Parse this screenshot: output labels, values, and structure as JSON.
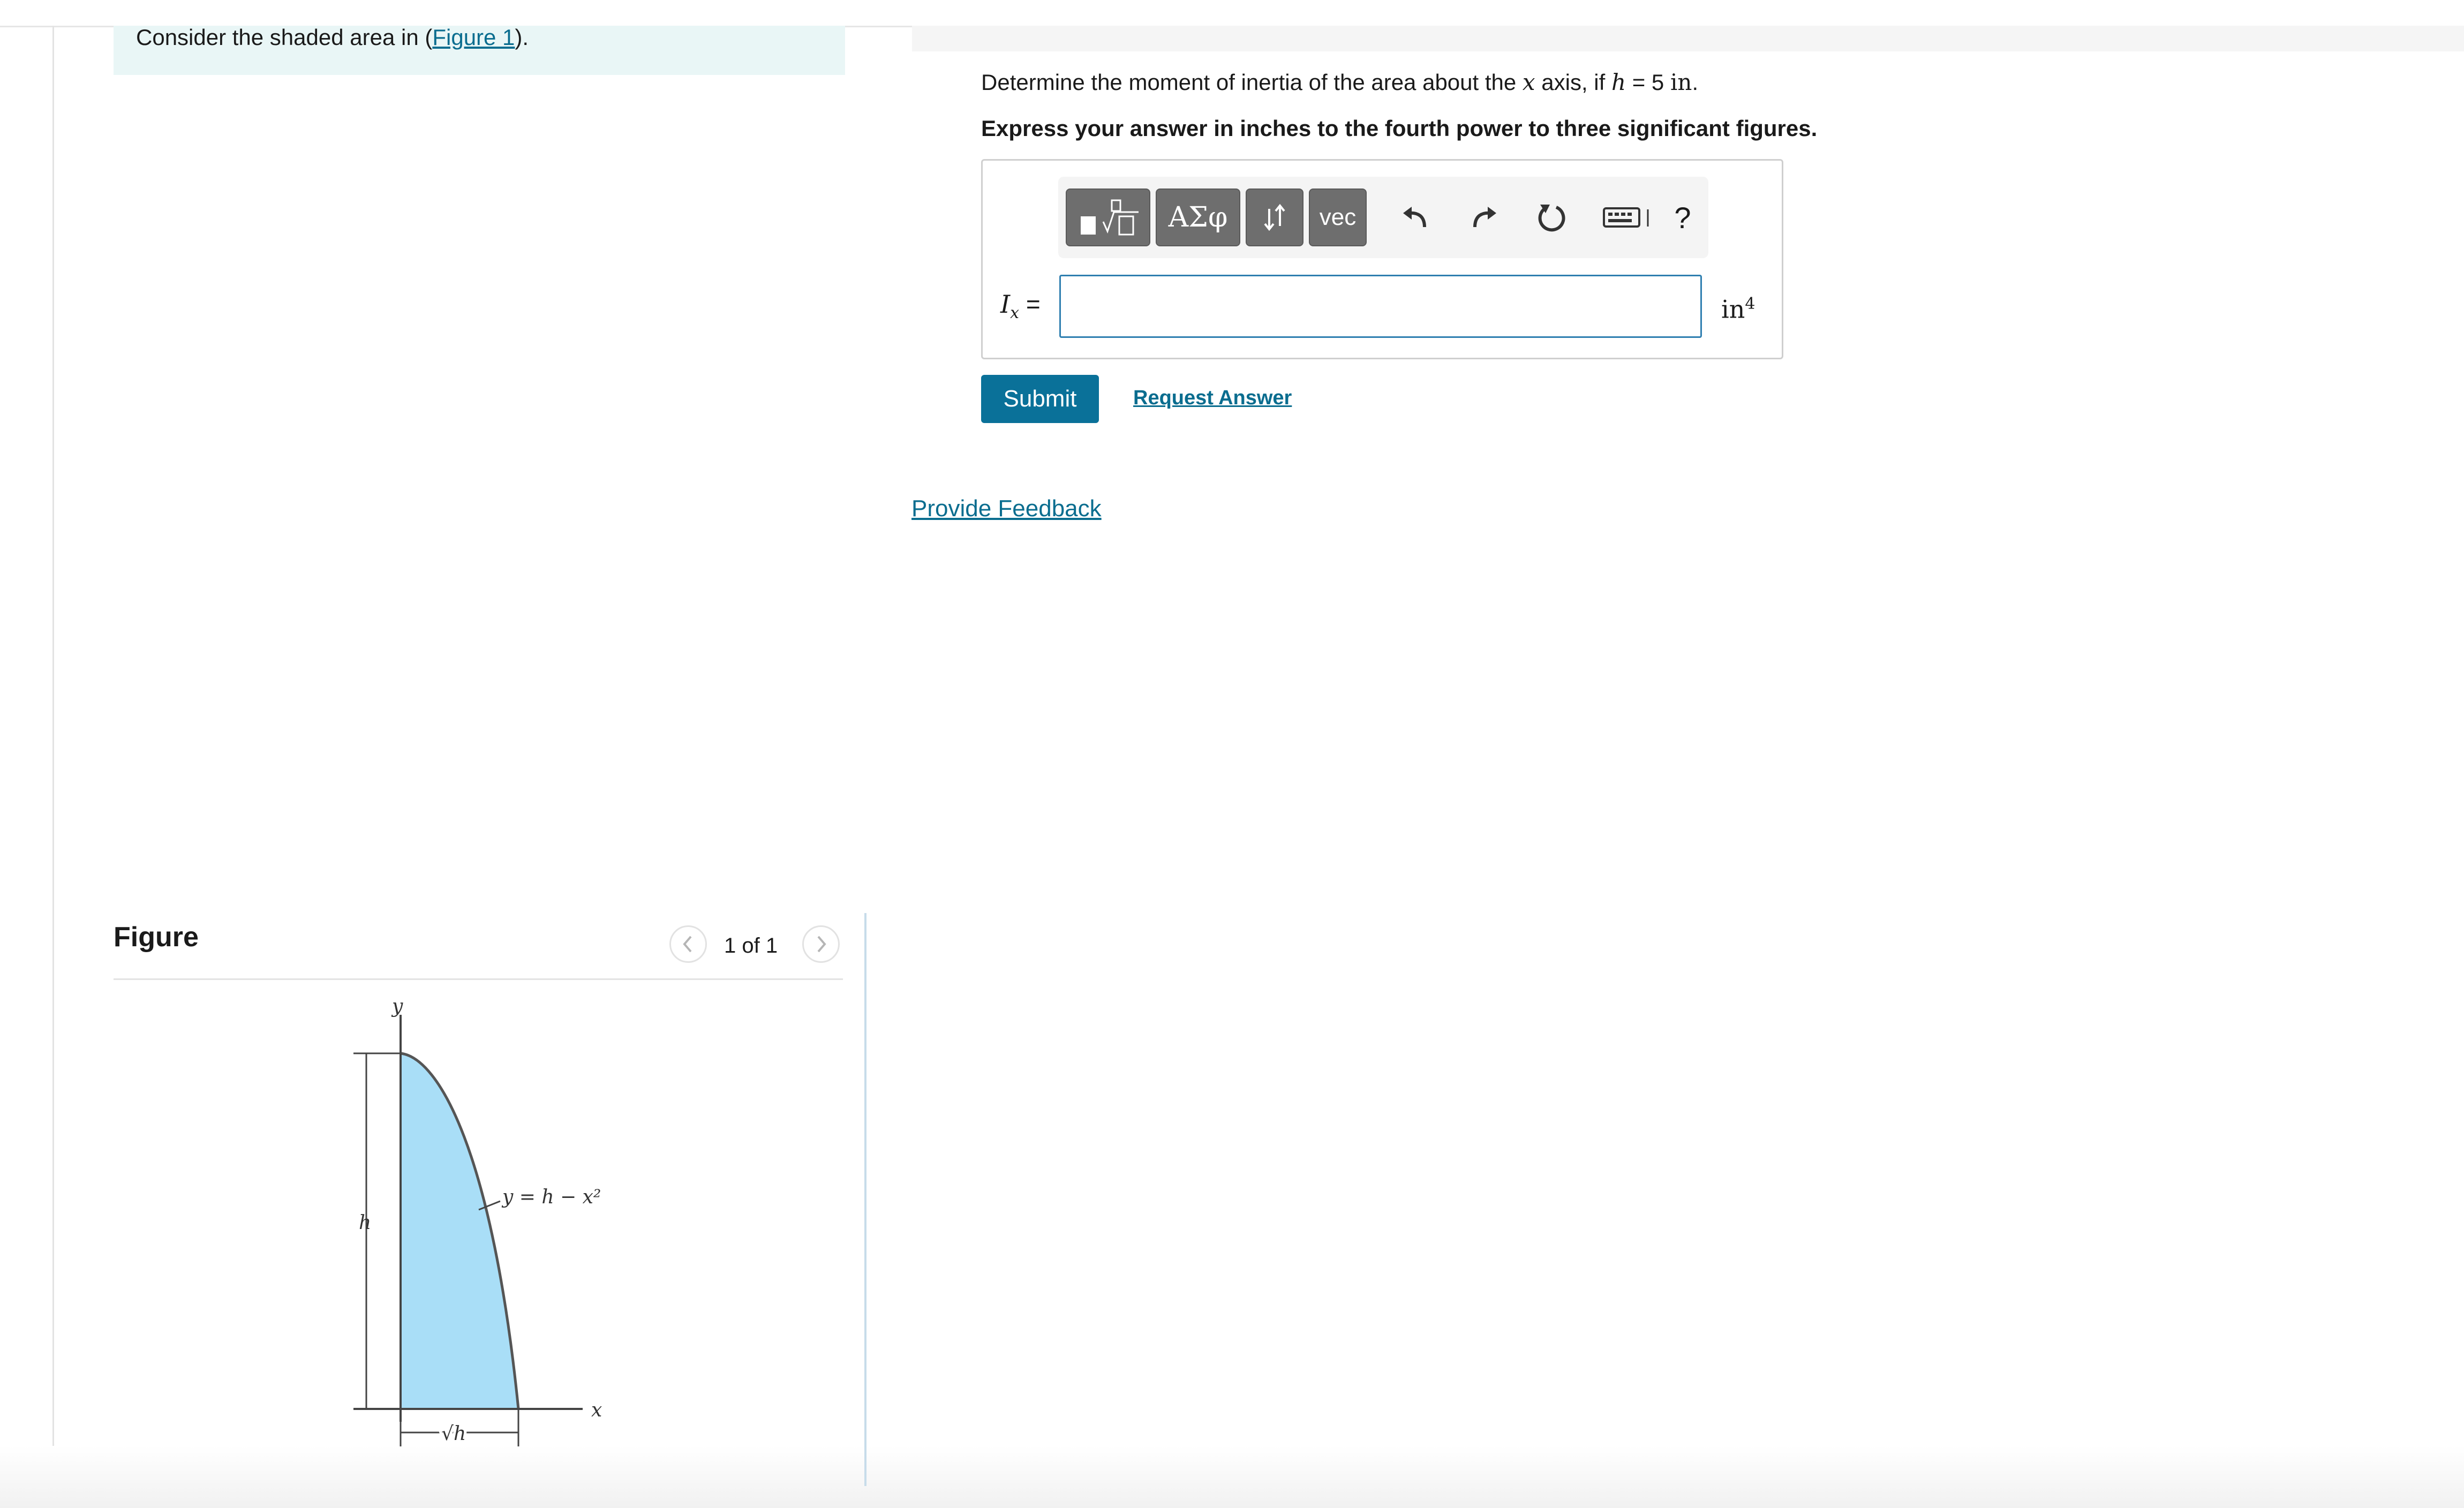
{
  "intro": {
    "text_before": "Consider the shaded area in (",
    "figure_link": "Figure 1",
    "text_after": ")."
  },
  "figure_panel": {
    "heading": "Figure",
    "pager": "1 of 1",
    "prev_icon": "chevron-left-icon",
    "next_icon": "chevron-right-icon",
    "labels": {
      "y_axis": "y",
      "x_axis": "x",
      "height": "h",
      "curve": "y = h − x²",
      "base": "√h"
    },
    "colors": {
      "shade": "#a9def7",
      "outline": "#555555"
    }
  },
  "question": {
    "part1": "Determine the moment of inertia of the area about the ",
    "var_x": "x",
    "part2": " axis, if ",
    "var_h": "h",
    "part3": " = 5 ",
    "unit": "in",
    "part4": "."
  },
  "instruction": "Express your answer in inches to the fourth power to three significant figures.",
  "toolbar": {
    "greek_label": "ΑΣφ",
    "vec_label": "vec",
    "help_label": "?",
    "icons": [
      "templates-icon",
      "greek-icon",
      "arrows-icon",
      "vec-icon",
      "undo-icon",
      "redo-icon",
      "reset-icon",
      "keyboard-icon",
      "help-icon"
    ]
  },
  "answer": {
    "symbol": "I",
    "subscript": "x",
    "equals": " =",
    "value": "",
    "unit_base": "in",
    "unit_exp": "4"
  },
  "actions": {
    "submit_label": "Submit",
    "request_answer_label": "Request Answer",
    "feedback_label": "Provide Feedback"
  },
  "colors": {
    "accent": "#0a7199",
    "link": "#0a6d8f",
    "intro_bg": "#e9f6f6",
    "input_border": "#2f7fb0"
  }
}
